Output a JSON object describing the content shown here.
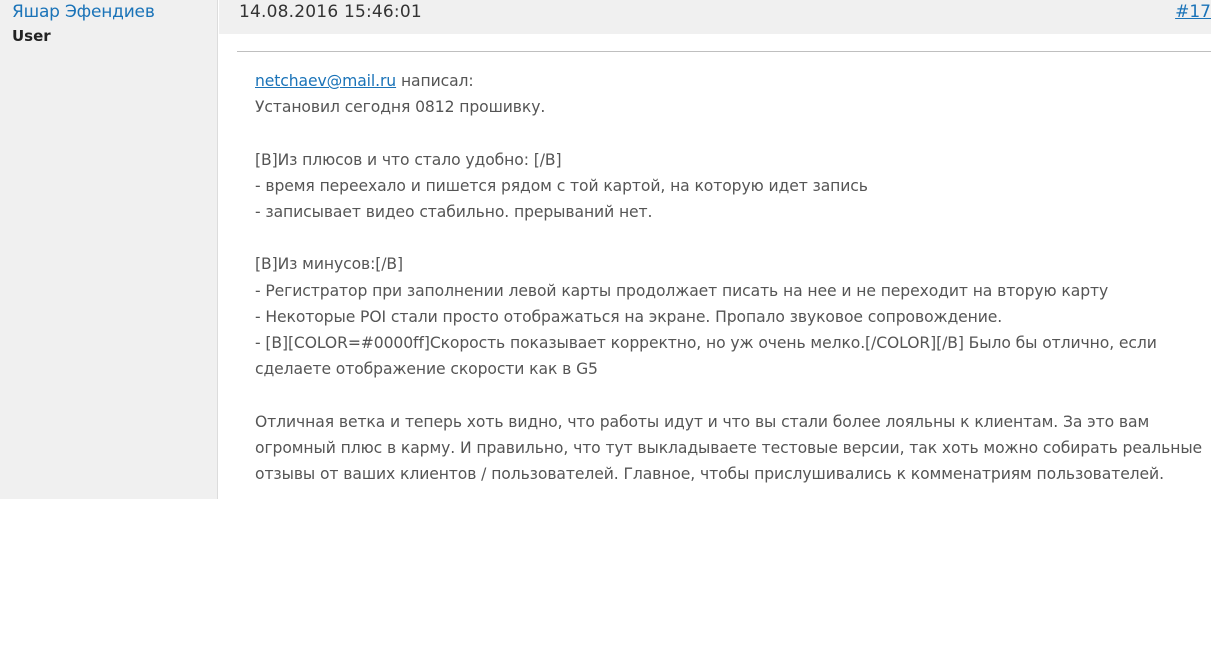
{
  "author": {
    "name": "Яшар Эфендиев",
    "role": "User"
  },
  "post": {
    "date": "14.08.2016 15:46:01",
    "number": "#17",
    "quote_author": "netchaev@mail.ru",
    "quote_suffix": " написал:",
    "lines": [
      "Установил сегодня 0812 прошивку.",
      "[B]Из плюсов и что стало удобно: [/B]",
      "- время переехало и пишется рядом с той картой, на которую идет запись",
      "- записывает видео стабильно. прерываний нет.",
      "[B]Из минусов:[/B]",
      "- Регистратор при заполнении левой карты продолжает писать на нее и не переходит на вторую карту",
      "- Некоторые POI стали просто отображаться на экране. Пропало звуковое сопровождение.",
      "- [B][COLOR=#0000ff]Скорость показывает корректно, но уж очень мелко.[/COLOR][/B] Было бы отлично, если сделаете отображение скорости как в G5",
      "Отличная ветка и теперь хоть видно, что работы идут и что вы стали более лояльны к клиентам. За это вам огромный плюс в карму. И правильно, что тут выкладываете тестовые версии, так хоть можно собирать реальные отзывы от ваших клиентов / пользователей. Главное, чтобы прислушивались к комменатриям пользователей."
    ]
  }
}
